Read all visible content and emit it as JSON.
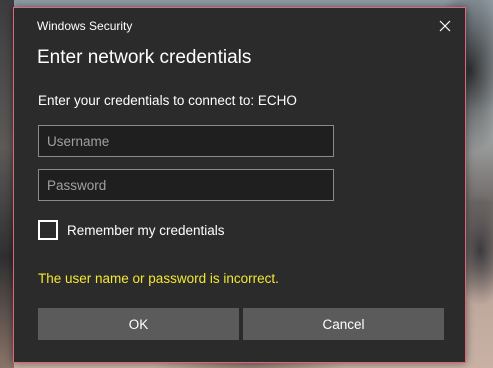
{
  "dialog": {
    "window_title": "Windows Security",
    "heading": "Enter network credentials",
    "subtitle": "Enter your credentials to connect to: ECHO",
    "username_field": {
      "value": "",
      "placeholder": "Username"
    },
    "password_field": {
      "value": "",
      "placeholder": "Password"
    },
    "remember_checkbox": {
      "label": "Remember my credentials",
      "checked": false
    },
    "error_message": "The user name or password is incorrect.",
    "ok_label": "OK",
    "cancel_label": "Cancel",
    "close_icon": "close-icon"
  },
  "colors": {
    "dialog_background": "#2b2b2b",
    "dialog_border": "#e0657a",
    "error_text": "#f4e832",
    "button_background": "#5b5b5b",
    "field_border": "#8a8a8a"
  }
}
